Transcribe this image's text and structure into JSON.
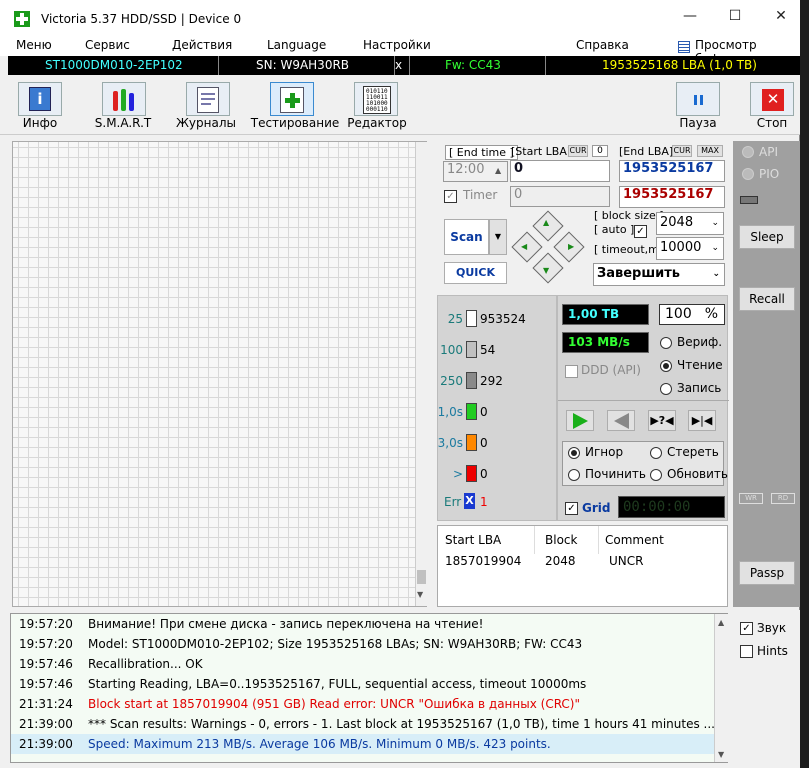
{
  "window": {
    "title": "Victoria 5.37 HDD/SSD | Device 0"
  },
  "menu": {
    "items": [
      "Меню",
      "Сервис",
      "Действия",
      "Language",
      "Настройки",
      "Справка",
      "Просмотр буфера"
    ]
  },
  "info": {
    "model": "ST1000DM010-2EP102",
    "sn": "SN: W9AH30RB",
    "x": "x",
    "fw": "Fw: CC43",
    "lba": "1953525168 LBA (1,0 TB)"
  },
  "toolbar": {
    "info": "Инфо",
    "smart": "S.M.A.R.T",
    "logs": "Журналы",
    "test": "Тестирование",
    "editor": "Редактор",
    "pause": "Пауза",
    "stop": "Стоп"
  },
  "controls": {
    "end_time_label": "[ End time ]",
    "end_time": "12:00",
    "timer": "Timer",
    "timer_value": "0",
    "start_lba_label": "[Start LBA]",
    "cur": "CUR",
    "cur_value": "0",
    "start_lba": "0",
    "end_lba_label": "[End LBA]",
    "cur2": "CUR",
    "max": "MAX",
    "end_lba": "1953525167",
    "end_lba2": "1953525167",
    "scan": "Scan",
    "quick": "QUICK",
    "block_size": "[ block size ]",
    "auto": "[ auto ]",
    "block_value": "2048",
    "timeout_label": "[ timeout,ms ]",
    "timeout_value": "10000",
    "finish": "Завершить"
  },
  "stats": {
    "rows": [
      {
        "t": "25",
        "c": "953524"
      },
      {
        "t": "100",
        "c": "54"
      },
      {
        "t": "250",
        "c": "292"
      },
      {
        "t": "1,0s",
        "c": "0"
      },
      {
        "t": "3,0s",
        "c": "0"
      },
      {
        "t": ">",
        "c": "0"
      }
    ],
    "err": "Err",
    "err_x": "X",
    "err_count": "1"
  },
  "colors": {
    "s25": "#ffffff",
    "s100": "#c0c0c0",
    "s250": "#8a8a8a",
    "s1s": "#22cc22",
    "s3s": "#ff8800",
    "sgt": "#ee0000",
    "accent": "#0a3aa0"
  },
  "readout": {
    "size": "1,00 TB",
    "pct": "100",
    "pct_unit": "%",
    "speed": "103 MB/s",
    "verify": "Вериф.",
    "read": "Чтение",
    "write": "Запись",
    "ddd": "DDD (API)",
    "ignore": "Игнор",
    "erase": "Стереть",
    "repair": "Починить",
    "refresh": "Обновить",
    "grid": "Grid",
    "clock": "00:00:00"
  },
  "table": {
    "headers": [
      "Start LBA",
      "Block",
      "Comment"
    ],
    "rows": [
      [
        "1857019904",
        "2048",
        "UNCR"
      ]
    ]
  },
  "side": {
    "api": "API",
    "pio": "PIO",
    "sleep": "Sleep",
    "recall": "Recall",
    "wr": "WR",
    "rd": "RD",
    "passp": "Passp",
    "sound": "Звук",
    "hints": "Hints"
  },
  "log": [
    {
      "time": "19:57:20",
      "msg": "Внимание! При смене диска - запись переключена на чтение!",
      "color": "#000"
    },
    {
      "time": "19:57:20",
      "msg": "Model: ST1000DM010-2EP102; Size 1953525168 LBAs; SN: W9AH30RB; FW: CC43",
      "color": "#000"
    },
    {
      "time": "19:57:46",
      "msg": "Recallibration... OK",
      "color": "#000"
    },
    {
      "time": "19:57:46",
      "msg": "Starting Reading, LBA=0..1953525167, FULL, sequential access, timeout 10000ms",
      "color": "#000"
    },
    {
      "time": "21:31:24",
      "msg": "Block start at 1857019904 (951 GB) Read error: UNCR \"Ошибка в данных (CRC)\"",
      "color": "#e00000"
    },
    {
      "time": "21:39:00",
      "msg": "*** Scan results: Warnings - 0, errors - 1. Last block at 1953525167 (1,0 TB), time 1 hours 41 minutes ...",
      "color": "#000"
    },
    {
      "time": "21:39:00",
      "msg": "Speed: Maximum 213 MB/s. Average 106 MB/s. Minimum 0 MB/s. 423 points.",
      "color": "#0a3aa0"
    }
  ]
}
